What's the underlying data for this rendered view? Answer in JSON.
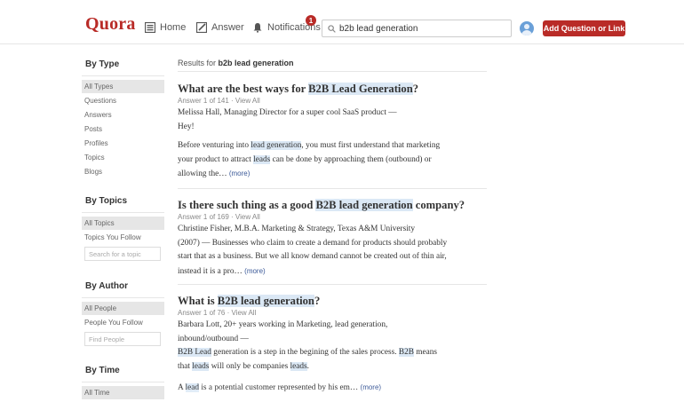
{
  "header": {
    "logo": "Quora",
    "nav": {
      "home": "Home",
      "answer": "Answer",
      "notifications": "Notifications",
      "notifications_count": "1"
    },
    "search_value": "b2b lead generation",
    "add_button": "Add Question or Link"
  },
  "sidebar": {
    "by_type": {
      "heading": "By Type",
      "items": [
        "All Types",
        "Questions",
        "Answers",
        "Posts",
        "Profiles",
        "Topics",
        "Blogs"
      ]
    },
    "by_topics": {
      "heading": "By Topics",
      "items": [
        "All Topics",
        "Topics You Follow"
      ],
      "placeholder": "Search for a topic"
    },
    "by_author": {
      "heading": "By Author",
      "items": [
        "All People",
        "People You Follow"
      ],
      "placeholder": "Find People"
    },
    "by_time": {
      "heading": "By Time",
      "items": [
        "All Time"
      ]
    }
  },
  "main": {
    "results_prefix": "Results for",
    "query": "b2b lead generation",
    "results": [
      {
        "title_pre": "What are the best ways for ",
        "title_hl": "B2B Lead Generation",
        "title_post": "?",
        "meta": "Answer 1 of 141 · View All",
        "author_line1": "Melissa Hall, Managing Director for a super cool SaaS product —",
        "author_line2": "Hey!",
        "l1_pre": "Before venturing into ",
        "l1_hl": "lead generation",
        "l1_post": ", you must first understand that marketing",
        "l2_pre": "your product to attract ",
        "l2_hl": "leads",
        "l2_post": " can be done by approaching them (outbound) or",
        "l3": "allowing the…",
        "more": "(more)"
      },
      {
        "title_pre": "Is there such thing as a good ",
        "title_hl": "B2B lead generation",
        "title_post": " company?",
        "meta": "Answer 1 of 169 · View All",
        "author_line1": "Christine Fisher, M.B.A. Marketing & Strategy, Texas A&M University",
        "l2": "(2007) — Businesses who claim to create a demand for products should probably",
        "l3": "start that as a business. But we all know demand cannot be created out of thin air,",
        "l4": "instead it is a pro…",
        "more": "(more)"
      },
      {
        "title_pre": "What is ",
        "title_hl": "B2B lead generation",
        "title_post": "?",
        "meta": "Answer 1 of 76 · View All",
        "author_line1": "Barbara Lott, 20+ years working in Marketing, lead generation,",
        "author_line2": "inbound/outbound —",
        "l1_hl1": "B2B Lead",
        "l1_mid": " generation is a step in the begining of the sales process. ",
        "l1_hl2": "B2B",
        "l1_post": " means",
        "l2_pre": "that ",
        "l2_hl1": "leads",
        "l2_mid": " will only be companies ",
        "l2_hl2": "leads",
        "l2_post": ".",
        "l3_pre": "A ",
        "l3_hl": "lead",
        "l3_post": " is a potential customer represented by his em…",
        "more": "(more)"
      }
    ]
  },
  "colors": {
    "brand": "#b92b27",
    "highlight": "#dbe8f5",
    "link": "#3b5998"
  }
}
